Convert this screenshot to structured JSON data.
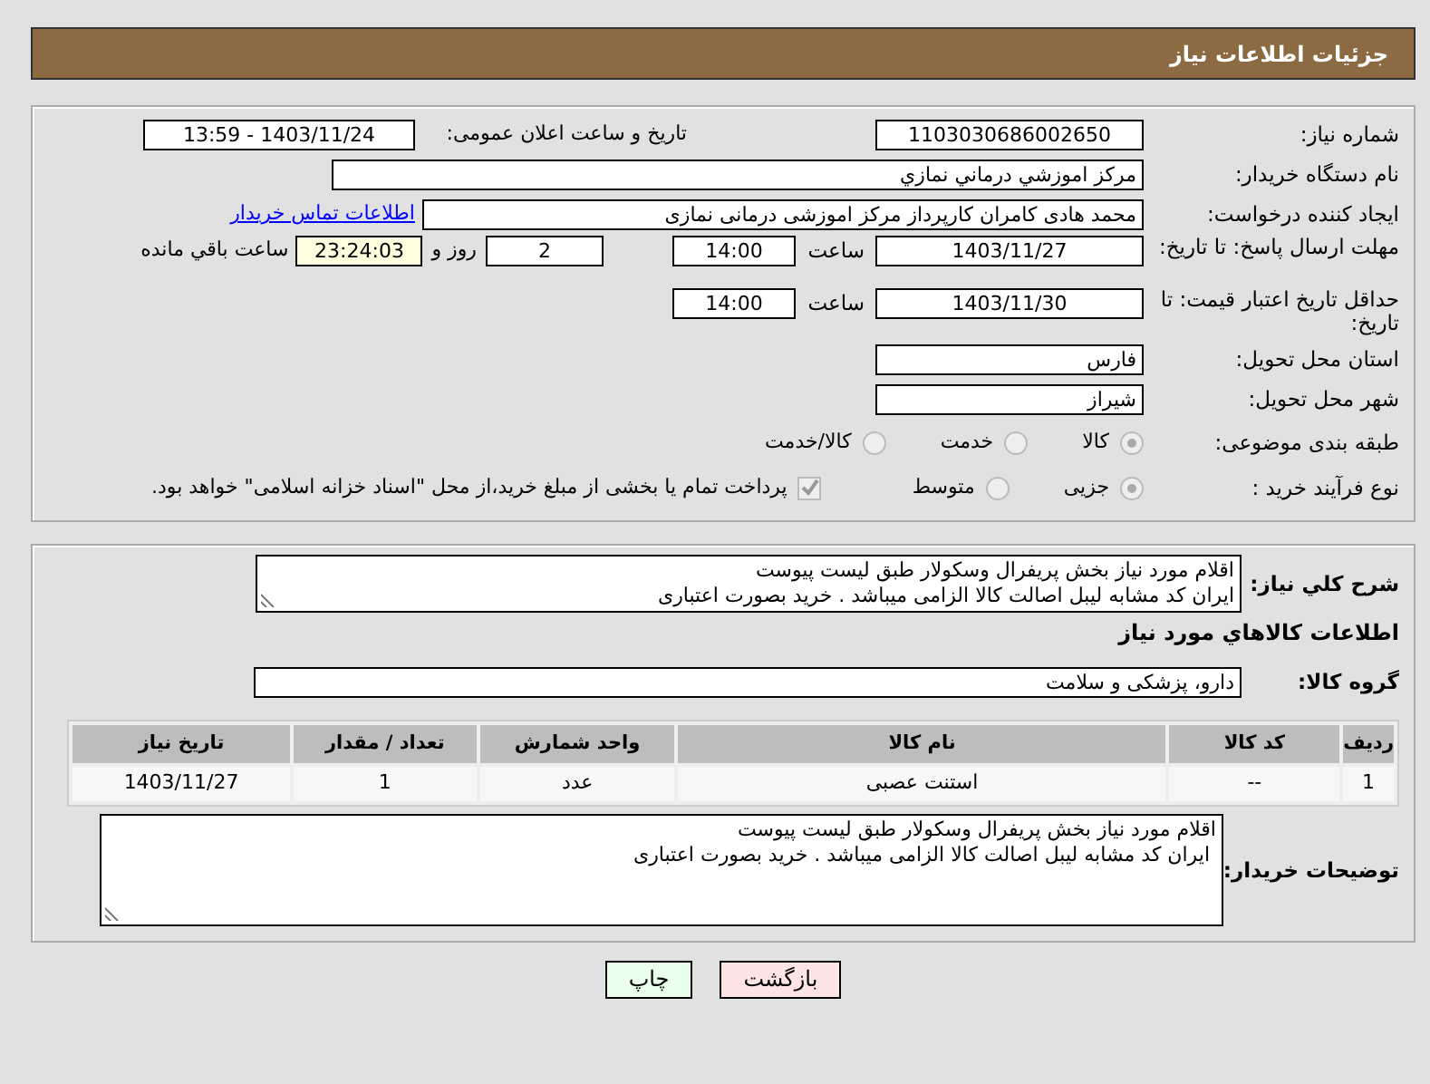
{
  "header": {
    "title": "جزئیات اطلاعات نیاز"
  },
  "need_number": {
    "label": "شماره نیاز:",
    "value": "1103030686002650"
  },
  "announce": {
    "label": "تاریخ و ساعت اعلان عمومی:",
    "value": "1403/11/24 - 13:59"
  },
  "buyer_org": {
    "label": "نام دستگاه خریدار:",
    "value": "مرکز اموزشي درماني نمازي"
  },
  "requester": {
    "label": "ایجاد کننده درخواست:",
    "value": "محمد هادی کامران کارپرداز مرکز اموزشی درمانی نمازی",
    "link": "اطلاعات تماس خریدار"
  },
  "reply_deadline": {
    "label": "مهلت ارسال پاسخ: تا تاریخ:",
    "date": "1403/11/27",
    "time_label": "ساعت",
    "time": "14:00",
    "days": "2",
    "days_label": "روز و",
    "remaining": "23:24:03",
    "remaining_label": "ساعت باقي مانده"
  },
  "price_validity": {
    "label": "حداقل تاریخ اعتبار قیمت: تا تاریخ:",
    "date": "1403/11/30",
    "time_label": "ساعت",
    "time": "14:00"
  },
  "province": {
    "label": "استان محل تحویل:",
    "value": "فارس"
  },
  "city": {
    "label": "شهر محل تحویل:",
    "value": "شیراز"
  },
  "category": {
    "label": "طبقه بندی موضوعی:",
    "options": [
      {
        "label": "کالا",
        "selected": true
      },
      {
        "label": "خدمت",
        "selected": false
      },
      {
        "label": "کالا/خدمت",
        "selected": false
      }
    ]
  },
  "process": {
    "label": "نوع فرآیند خرید :",
    "options": [
      {
        "label": "جزیی",
        "selected": true
      },
      {
        "label": "متوسط",
        "selected": false
      }
    ],
    "payment": {
      "checked": true,
      "text": "پرداخت تمام یا بخشی از مبلغ خرید،از محل \"اسناد خزانه اسلامی\" خواهد بود."
    }
  },
  "description": {
    "label": "شرح کلي نياز:",
    "lines": [
      "اقلام مورد نیاز بخش پریفرال وسکولار طبق لیست پیوست",
      "ایران کد مشابه لیبل اصالت کالا الزامی میباشد . خرید بصورت اعتباری"
    ]
  },
  "goods_title": "اطلاعات کالاهاي مورد نياز",
  "goods_group": {
    "label": "گروه کالا:",
    "value": "دارو، پزشکی و سلامت"
  },
  "table": {
    "columns": [
      "ردیف",
      "کد کالا",
      "نام کالا",
      "واحد شمارش",
      "تعداد / مقدار",
      "تاریخ نیاز"
    ],
    "rows": [
      [
        "1",
        "--",
        "استنت عصبی",
        "عدد",
        "1",
        "1403/11/27"
      ]
    ]
  },
  "buyer_notes": {
    "label": "توضیحات خریدار:",
    "lines": [
      "اقلام مورد نیاز بخش پریفرال وسکولار طبق لیست پیوست",
      " ایران کد مشابه لیبل اصالت کالا الزامی میباشد . خرید بصورت اعتباری"
    ]
  },
  "buttons": [
    {
      "label": "بازگشت",
      "kind": "back"
    },
    {
      "label": "چاپ",
      "kind": "print"
    }
  ]
}
